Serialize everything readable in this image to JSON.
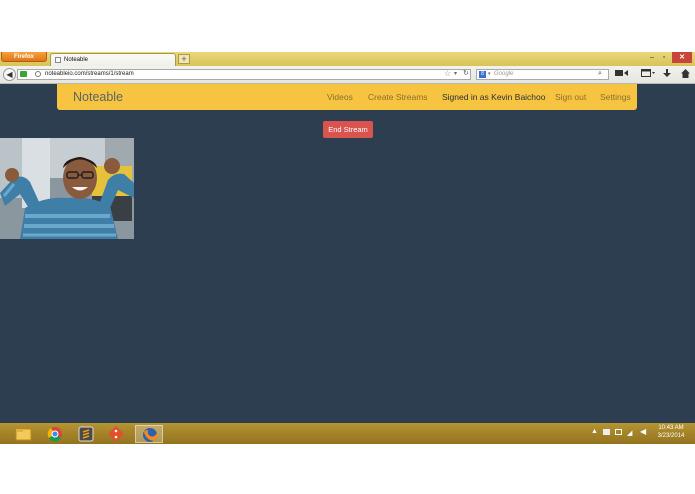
{
  "browser": {
    "menu_button_label": "Firefox",
    "tab_title": "Noteable",
    "new_tab_symbol": "+",
    "url": "noteableio.com/streams/1/stream",
    "search_placeholder": "Google",
    "search_engine_badge": "8",
    "window_controls": {
      "minimize": "–",
      "maximize": "▫",
      "close": "✕"
    },
    "icons": {
      "back": "arrow-left-icon",
      "camera": "camera-icon",
      "globe": "globe-icon",
      "star": "star-icon",
      "reload": "reload-icon",
      "search": "magnifier-icon",
      "video": "video-icon",
      "window": "window-icon",
      "download": "download-icon",
      "home": "home-icon"
    }
  },
  "app": {
    "brand": "Noteable",
    "nav": {
      "videos": "Videos",
      "create_streams": "Create Streams",
      "signed_in": "Signed in as Kevin Baichoo",
      "sign_out": "Sign out",
      "settings": "Settings"
    },
    "end_stream_label": "End Stream",
    "colors": {
      "page_background": "#2c3e50",
      "navbar": "#f7c441",
      "danger": "#d9534f"
    }
  },
  "taskbar": {
    "apps": [
      "file-explorer-icon",
      "chrome-icon",
      "sublime-text-icon",
      "git-icon",
      "firefox-icon"
    ],
    "active_app": "firefox-icon",
    "clock_time": "10:43 AM",
    "clock_date": "3/23/2014"
  }
}
